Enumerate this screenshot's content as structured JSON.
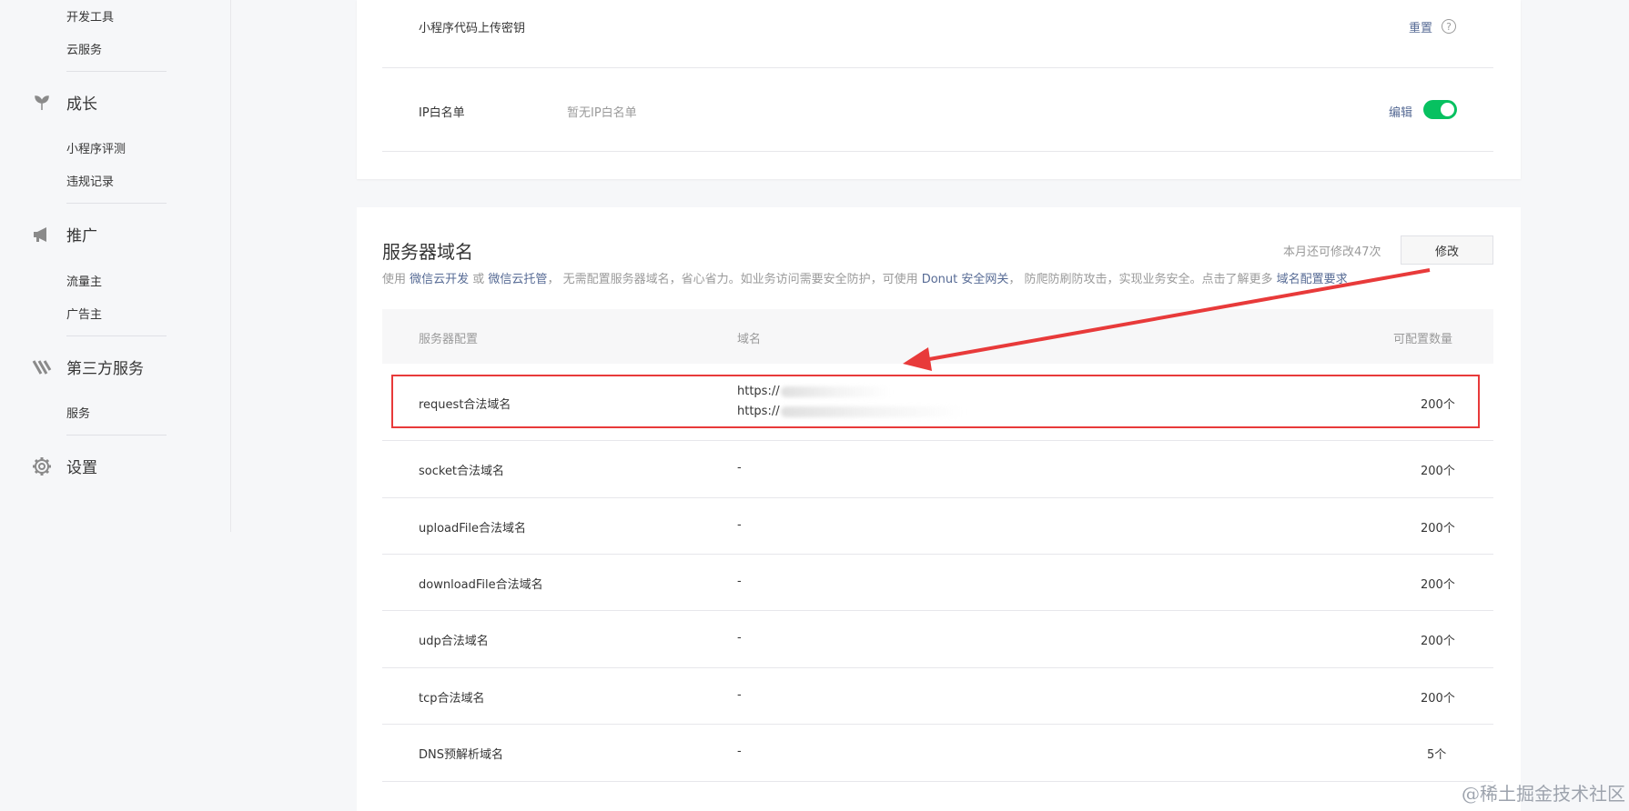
{
  "sidebar": {
    "groups": [
      {
        "label": "成长",
        "icon": "sprout-icon"
      },
      {
        "label": "推广",
        "icon": "megaphone-icon"
      },
      {
        "label": "第三方服务",
        "icon": "third-party-icon"
      },
      {
        "label": "设置",
        "icon": "gear-icon"
      }
    ],
    "items": [
      "开发工具",
      "云服务",
      "小程序评测",
      "违规记录",
      "流量主",
      "广告主",
      "服务"
    ]
  },
  "dev_settings": {
    "upload_key_label": "小程序代码上传密钥",
    "reset_label": "重置",
    "ip_whitelist_label": "IP白名单",
    "ip_whitelist_value": "暂无IP白名单",
    "edit_label": "编辑",
    "toggle_on": true
  },
  "server_domain": {
    "title": "服务器域名",
    "quota_text": "本月还可修改47次",
    "modify_label": "修改",
    "desc": {
      "p1": "使用 ",
      "link1": "微信云开发",
      "p2": " 或 ",
      "link2": "微信云托管",
      "p3": "， 无需配置服务器域名，省心省力。如业务访问需要安全防护，可使用 ",
      "link3": "Donut 安全网关",
      "p4": "， 防爬防刷防攻击，实现业务安全。点击了解更多 ",
      "link4": "域名配置要求"
    },
    "columns": [
      "服务器配置",
      "域名",
      "可配置数量"
    ],
    "rows": [
      {
        "name": "request合法域名",
        "domains": [
          "https://",
          "https://"
        ],
        "count": "200个"
      },
      {
        "name": "socket合法域名",
        "domains": [
          "-"
        ],
        "count": "200个"
      },
      {
        "name": "uploadFile合法域名",
        "domains": [
          "-"
        ],
        "count": "200个"
      },
      {
        "name": "downloadFile合法域名",
        "domains": [
          "-"
        ],
        "count": "200个"
      },
      {
        "name": "udp合法域名",
        "domains": [
          "-"
        ],
        "count": "200个"
      },
      {
        "name": "tcp合法域名",
        "domains": [
          "-"
        ],
        "count": "200个"
      },
      {
        "name": "DNS预解析域名",
        "domains": [
          "-"
        ],
        "count": "5个"
      }
    ]
  },
  "watermark": "@稀土掘金技术社区",
  "colors": {
    "annotation_red": "#e83a3a",
    "toggle_green": "#07c160",
    "link_blue": "#576b95"
  }
}
